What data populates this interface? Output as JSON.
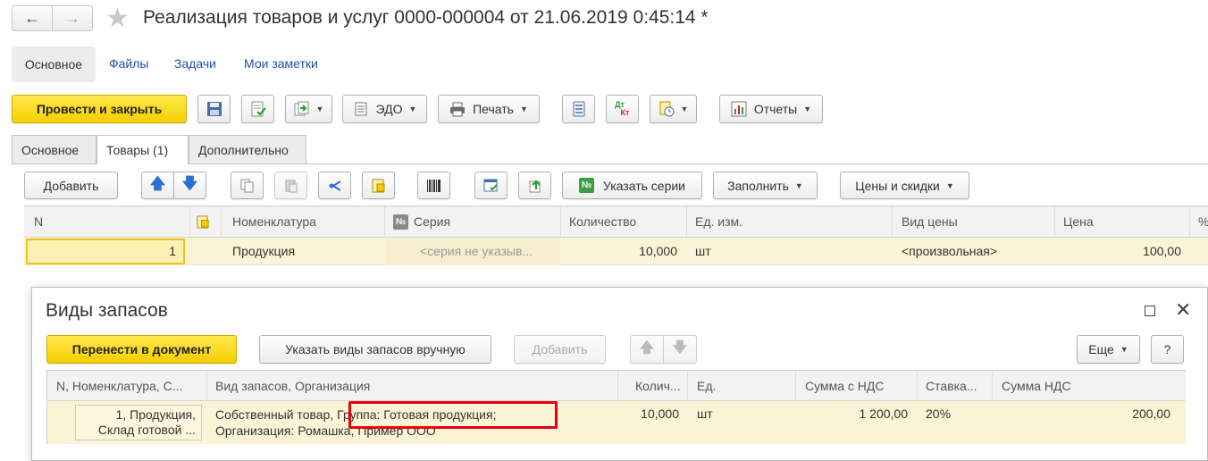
{
  "window": {
    "title": "Реализация товаров и услуг 0000-000004 от 21.06.2019 0:45:14 *"
  },
  "nav_links": {
    "main": "Основное",
    "files": "Файлы",
    "tasks": "Задачи",
    "notes": "Мои заметки"
  },
  "toolbar": {
    "post_close": "Провести и закрыть",
    "edo": "ЭДО",
    "print": "Печать",
    "reports": "Отчеты",
    "dtkt_top": "Дт",
    "dtkt_bottom": "Кт"
  },
  "tabs": {
    "main": "Основное",
    "goods": "Товары (1)",
    "extra": "Дополнительно"
  },
  "goods_toolbar": {
    "add": "Добавить",
    "series": "Указать серии",
    "fill": "Заполнить",
    "prices": "Цены и скидки",
    "series_icon_text": "№"
  },
  "goods_table": {
    "columns": {
      "n": "N",
      "nomenclature": "Номенклатура",
      "series": "Серия",
      "series_icon_text": "№",
      "qty": "Количество",
      "unit": "Ед. изм.",
      "price_type": "Вид цены",
      "price": "Цена",
      "pct": "%"
    },
    "rows": [
      {
        "n": "1",
        "nomenclature": "Продукция",
        "series": "<серия не указыв...",
        "qty": "10,000",
        "unit": "шт",
        "price_type": "<произвольная>",
        "price": "100,00"
      }
    ]
  },
  "dialog": {
    "title": "Виды запасов",
    "transfer": "Перенести в документ",
    "manual": "Указать виды запасов вручную",
    "add": "Добавить",
    "more": "Еще",
    "help": "?",
    "columns": {
      "n": "N, Номенклатура, С...",
      "stock_type": "Вид запасов, Организация",
      "qty": "Колич...",
      "unit": "Ед.",
      "sum_vat": "Сумма с НДС",
      "rate": "Ставка...",
      "vat": "Сумма НДС"
    },
    "rows": [
      {
        "n_line1": "1, Продукция,",
        "n_line2": "Склад готовой ...",
        "stock_line1_a": "Собственный товар,",
        "stock_line1_b": "Группа: Готовая продукция;",
        "stock_line2": "Организация: Ромашка, Пример ООО",
        "qty": "10,000",
        "unit": "шт",
        "sum_vat": "1 200,00",
        "rate": "20%",
        "vat": "200,00"
      }
    ]
  },
  "colors": {
    "accent_yellow": "#f5cf00",
    "selected_row": "#fbf3d6",
    "link": "#1d4fa8",
    "highlight_box": "#e8000d"
  }
}
